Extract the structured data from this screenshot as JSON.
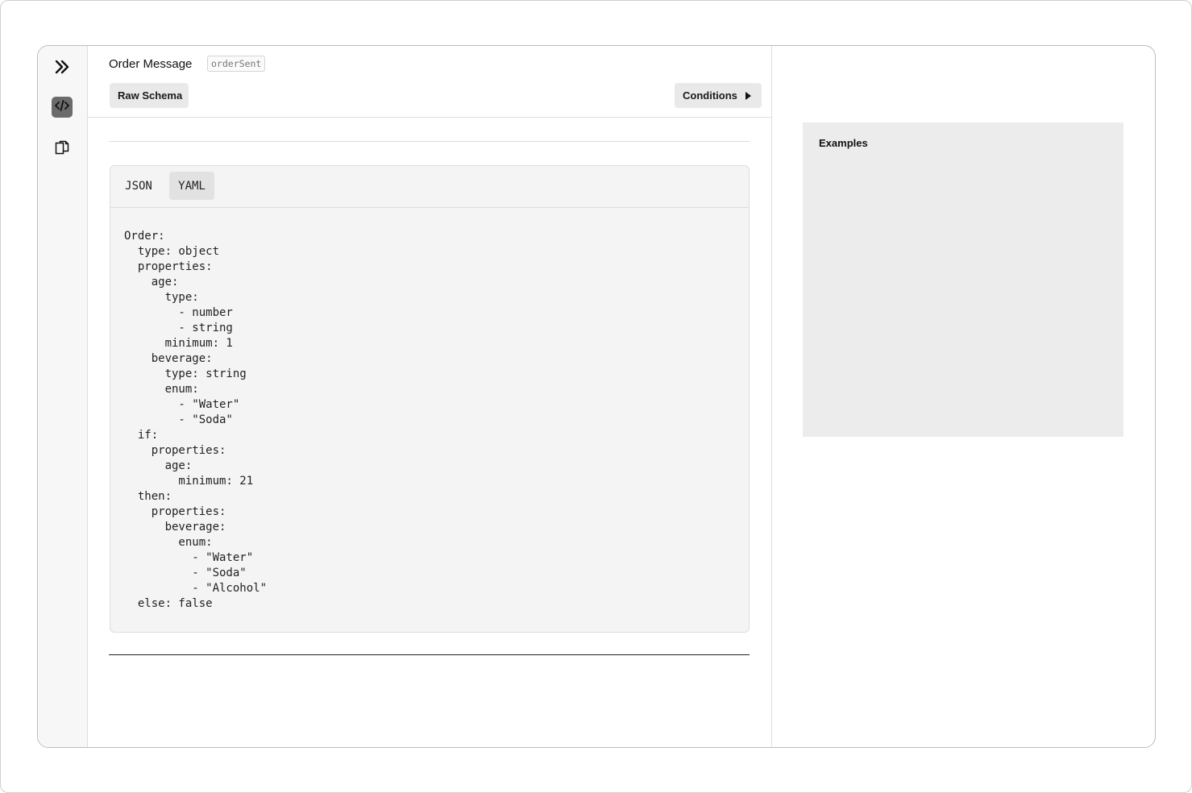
{
  "sidebar": {
    "icons": [
      "expand-icon",
      "code-icon",
      "documents-icon"
    ]
  },
  "header": {
    "title": "Order Message",
    "tag": "orderSent",
    "raw_schema_label": "Raw Schema",
    "conditions_label": "Conditions"
  },
  "code_view": {
    "tabs": [
      "JSON",
      "YAML"
    ],
    "active_tab": "YAML",
    "yaml": "Order:\n  type: object\n  properties:\n    age:\n      type:\n        - number\n        - string\n      minimum: 1\n    beverage:\n      type: string\n      enum:\n        - \"Water\"\n        - \"Soda\"\n  if:\n    properties:\n      age:\n        minimum: 21\n  then:\n    properties:\n      beverage:\n        enum:\n          - \"Water\"\n          - \"Soda\"\n          - \"Alcohol\"\n  else: false"
  },
  "examples": {
    "title": "Examples"
  }
}
